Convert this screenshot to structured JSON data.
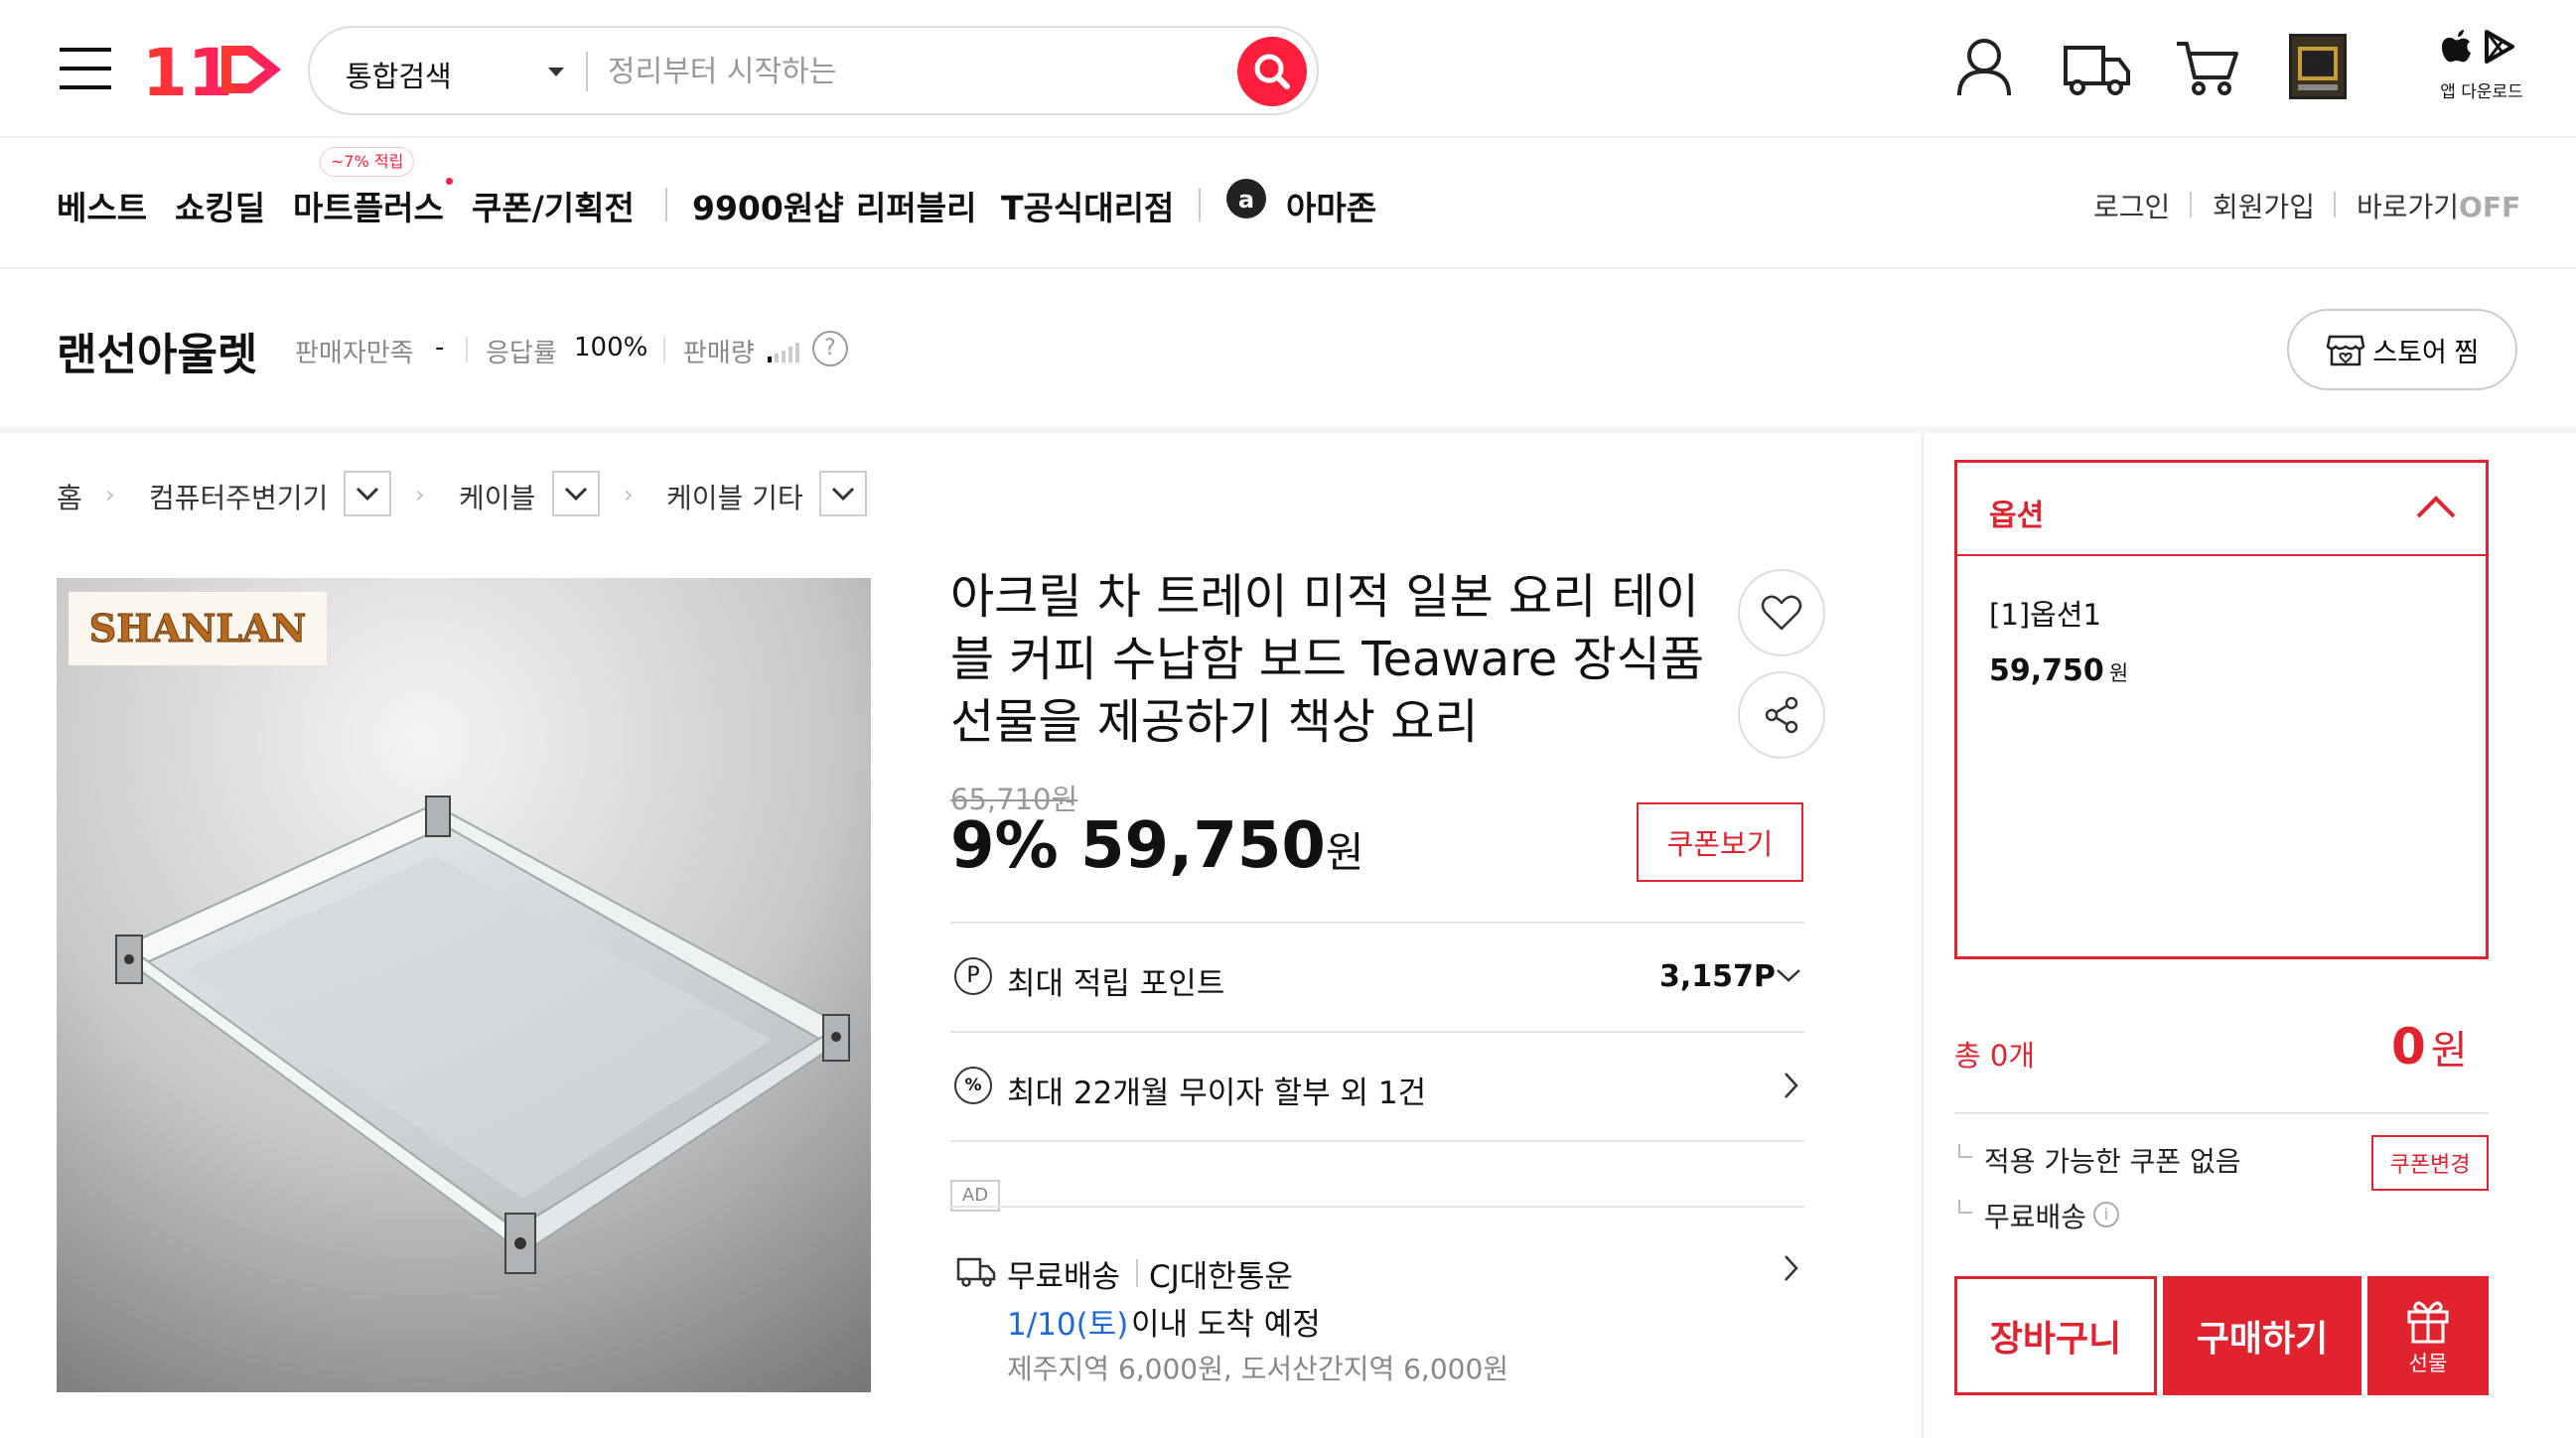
{
  "header": {
    "logo_text": "11",
    "search_scope": "통합검색",
    "search_placeholder": "정리부터 시작하는",
    "app_download": "앱 다운로드"
  },
  "nav": {
    "items": [
      "베스트",
      "쇼킹딜",
      "마트플러스",
      "쿠폰/기획전",
      "9900원샵",
      "리퍼블리",
      "T공식대리점",
      "아마존"
    ],
    "badge": "~7% 적립",
    "right": [
      "로그인",
      "회원가입",
      "바로가기"
    ],
    "shortcut_state": "OFF"
  },
  "seller": {
    "name": "랜선아울렛",
    "satisfaction_label": "판매자만족",
    "satisfaction_value": "-",
    "response_label": "응답률",
    "response_value": "100%",
    "sales_label": "판매량",
    "store_fav_label": "스토어 찜"
  },
  "breadcrumb": [
    "홈",
    "컴퓨터주변기기",
    "케이블",
    "케이블 기타"
  ],
  "product": {
    "image_logo": "SHANLAN",
    "title": "아크릴 차 트레이 미적 일본 요리 테이블 커피 수납함 보드 Teaware 장식품 선물을 제공하기 책상 요리",
    "original_price": "65,710원",
    "discount": "9%",
    "price": "59,750",
    "price_unit": "원",
    "coupon_button": "쿠폰보기",
    "points_label": "최대 적립 포인트",
    "points_value": "3,157P",
    "installment": "최대 22개월 무이자 할부 외 1건",
    "ad_label": "AD",
    "shipping_label": "무료배송",
    "shipping_carrier": "CJ대한통운",
    "delivery_date": "1/10(토)",
    "delivery_suffix": "이내 도착 예정",
    "extra_shipping": "제주지역 6,000원, 도서산간지역 6,000원"
  },
  "order_panel": {
    "option_title": "옵션",
    "option_name": "[1]옵션1",
    "option_price": "59,750",
    "option_price_unit": "원",
    "total_count_label": "총 0개",
    "total_price": "0",
    "total_unit": "원",
    "coupon_note": "적용 가능한 쿠폰 없음",
    "coupon_change": "쿠폰변경",
    "free_shipping": "무료배송",
    "cart_button": "장바구니",
    "buy_button": "구매하기",
    "gift_button": "선물"
  },
  "colors": {
    "brand_red": "#e0232f",
    "search_red": "#ff1e3c",
    "delivery_blue": "#1f6bd6"
  }
}
